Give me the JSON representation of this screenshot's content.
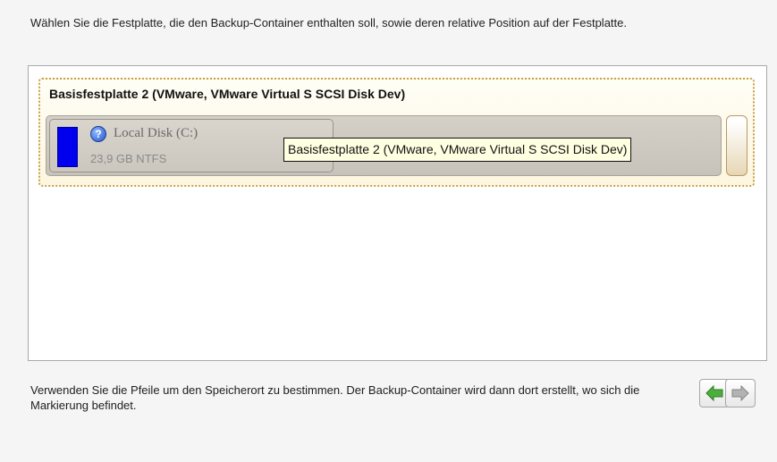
{
  "instructions": {
    "top": "Wählen Sie die Festplatte, die den Backup-Container enthalten soll, sowie deren relative Position auf der Festplatte.",
    "bottom": "Verwenden Sie die Pfeile um den Speicherort zu bestimmen. Der Backup-Container wird dann dort erstellt, wo sich die Markierung befindet."
  },
  "disk": {
    "title": "Basisfestplatte 2 (VMware, VMware Virtual S SCSI Disk Dev)",
    "partition": {
      "name": "Local Disk (C:)",
      "info": "23,9 GB NTFS",
      "icon": "help-icon",
      "usage_color": "#0000ee"
    },
    "tooltip": "Basisfestplatte 2 (VMware, VMware Virtual S SCSI Disk Dev)"
  },
  "navigation": {
    "left_icon": "arrow-left-icon",
    "right_icon": "arrow-right-icon",
    "left_color": "#4caf3c",
    "right_color": "#9a9a9a"
  },
  "colors": {
    "selection_border": "#c8a04a",
    "selection_background": "#fdf6df",
    "tooltip_background": "#ffffe1"
  }
}
